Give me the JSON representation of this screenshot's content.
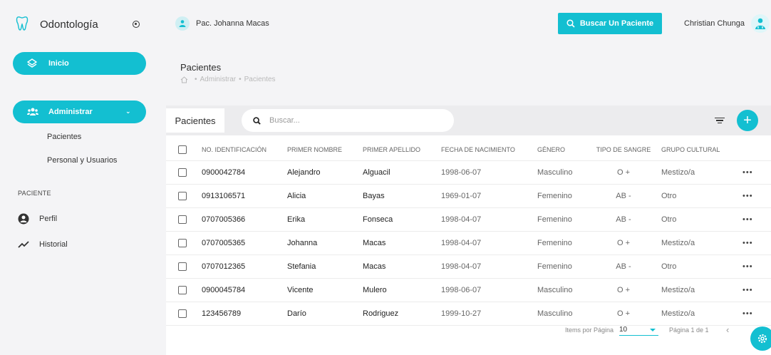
{
  "brand": {
    "title": "Odontología"
  },
  "sidebar": {
    "inicio": "Inicio",
    "administrar": "Administrar",
    "sub_items": [
      "Pacientes",
      "Personal y Usuarios"
    ],
    "section": "PACIENTE",
    "perfil": "Perfil",
    "historial": "Historial"
  },
  "header": {
    "patient": "Pac. Johanna Macas",
    "search_button": "Buscar Un Paciente",
    "user": "Christian Chunga"
  },
  "page": {
    "title": "Pacientes",
    "breadcrumb": [
      "Administrar",
      "Pacientes"
    ]
  },
  "card": {
    "title": "Pacientes",
    "search_placeholder": "Buscar..."
  },
  "table": {
    "columns": [
      "NO. IDENTIFICACIÓN",
      "PRIMER NOMBRE",
      "PRIMER APELLIDO",
      "FECHA DE NACIMIENTO",
      "GÉNERO",
      "TIPO DE SANGRE",
      "GRUPO CULTURAL"
    ],
    "rows": [
      [
        "0900042784",
        "Alejandro",
        "Alguacil",
        "1998-06-07",
        "Masculino",
        "O +",
        "Mestizo/a"
      ],
      [
        "0913106571",
        "Alicia",
        "Bayas",
        "1969-01-07",
        "Femenino",
        "AB -",
        "Otro"
      ],
      [
        "0707005366",
        "Erika",
        "Fonseca",
        "1998-04-07",
        "Femenino",
        "AB -",
        "Otro"
      ],
      [
        "0707005365",
        "Johanna",
        "Macas",
        "1998-04-07",
        "Femenino",
        "O +",
        "Mestizo/a"
      ],
      [
        "0707012365",
        "Stefania",
        "Macas",
        "1998-04-07",
        "Femenino",
        "AB -",
        "Otro"
      ],
      [
        "0900045784",
        "Vicente",
        "Mulero",
        "1998-06-07",
        "Masculino",
        "O +",
        "Mestizo/a"
      ],
      [
        "123456789",
        "Darío",
        "Rodriguez",
        "1999-10-27",
        "Masculino",
        "O +",
        "Mestizo/a"
      ]
    ]
  },
  "pager": {
    "items_label": "Items por Página",
    "items_value": "10",
    "page_label": "Página 1 de 1"
  },
  "colors": {
    "accent": "#13bfd1"
  }
}
